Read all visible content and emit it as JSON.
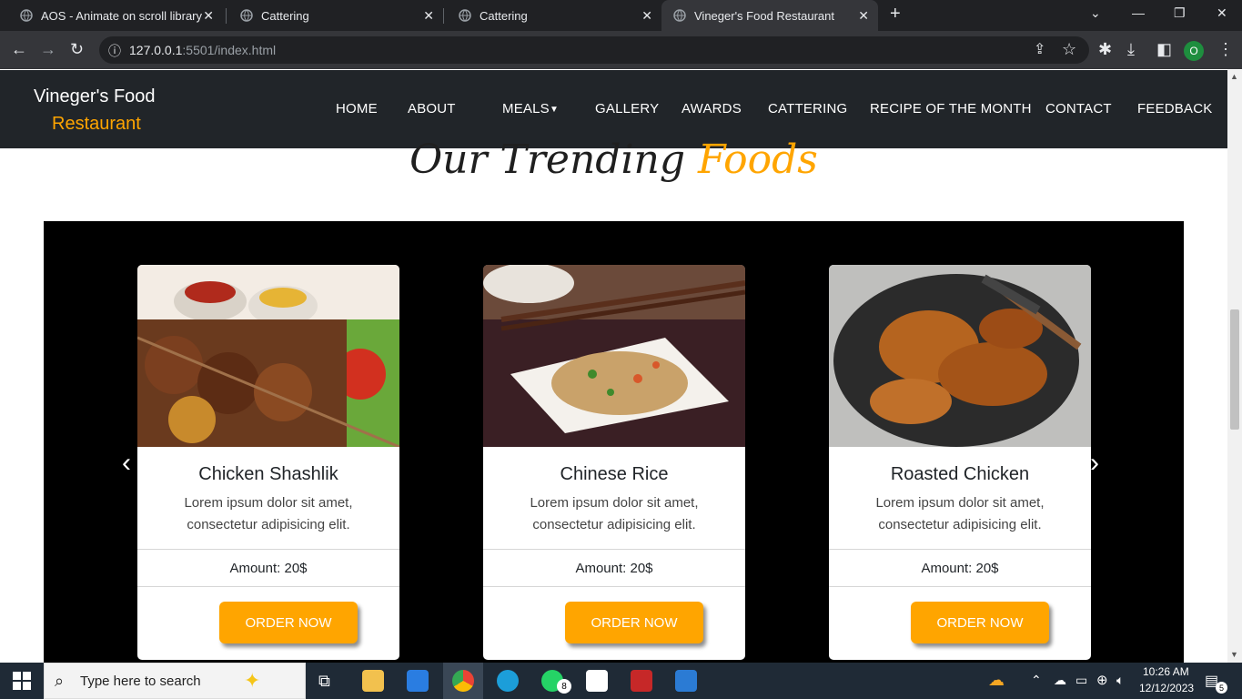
{
  "browser": {
    "tabs": [
      {
        "title": "AOS - Animate on scroll library"
      },
      {
        "title": "Cattering"
      },
      {
        "title": "Cattering"
      },
      {
        "title": "Vineger's Food Restaurant"
      }
    ],
    "url_host": "127.0.0.1",
    "url_rest": ":5501/index.html",
    "profile_initial": "O"
  },
  "site": {
    "brand_line1": "Vineger's Food",
    "brand_line2": "Restaurant",
    "nav": [
      "HOME",
      "ABOUT",
      "MEALS",
      "GALLERY",
      "AWARDS",
      "CATTERING",
      "RECIPE OF THE MONTH",
      "CONTACT",
      "FEEDBACK"
    ],
    "heading_part1": "Our Trending ",
    "heading_part2": "Foods",
    "cards": [
      {
        "title": "Chicken Shashlik",
        "desc": "Lorem ipsum dolor sit amet, consectetur adipisicing elit.",
        "amount": "Amount: 20$",
        "button": "ORDER NOW"
      },
      {
        "title": "Chinese Rice",
        "desc": "Lorem ipsum dolor sit amet, consectetur adipisicing elit.",
        "amount": "Amount: 20$",
        "button": "ORDER NOW"
      },
      {
        "title": "Roasted Chicken",
        "desc": "Lorem ipsum dolor sit amet, consectetur adipisicing elit.",
        "amount": "Amount: 20$",
        "button": "ORDER NOW"
      }
    ]
  },
  "taskbar": {
    "search_placeholder": "Type here to search",
    "whatsapp_badge": "8",
    "time": "10:26 AM",
    "date": "12/12/2023",
    "notification_count": "5"
  },
  "colors": {
    "accent": "#ffa500",
    "nav_bg": "#212529",
    "chrome_bg": "#202124"
  }
}
